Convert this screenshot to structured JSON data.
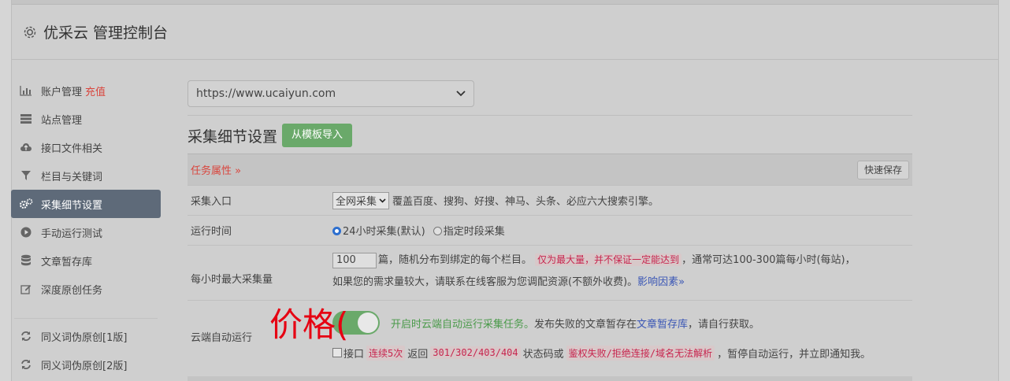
{
  "header": {
    "title": "优采云 管理控制台",
    "icon": "gear-icon"
  },
  "sidebar": {
    "items": [
      {
        "label": "账户管理",
        "tag": "充值",
        "icon": "bar-chart-icon"
      },
      {
        "label": "站点管理",
        "icon": "server-icon"
      },
      {
        "label": "接口文件相关",
        "icon": "cloud-upload-icon"
      },
      {
        "label": "栏目与关键词",
        "icon": "filter-icon"
      },
      {
        "label": "采集细节设置",
        "icon": "cogs-icon",
        "active": true
      },
      {
        "label": "手动运行测试",
        "icon": "play-icon"
      },
      {
        "label": "文章暂存库",
        "icon": "database-icon"
      },
      {
        "label": "深度原创任务",
        "icon": "edit-icon"
      },
      {
        "label": "同义词伪原创[1版]",
        "icon": "refresh-icon"
      },
      {
        "label": "同义词伪原创[2版]",
        "icon": "refresh-icon"
      }
    ]
  },
  "main": {
    "site_select": {
      "value": "https://www.ucaiyun.com"
    },
    "section_title": "采集细节设置",
    "import_button": "从模板导入",
    "props_label": "任务属性 »",
    "quick_save": "快速保存",
    "rows": {
      "entry": {
        "label": "采集入口",
        "select": "全网采集",
        "desc": "覆盖百度、搜狗、好搜、神马、头条、必应六大搜索引擎。"
      },
      "time": {
        "label": "运行时间",
        "opt1": "24小时采集(默认)",
        "opt2": "指定时段采集"
      },
      "max": {
        "label": "每小时最大采集量",
        "value": "100",
        "t1": "篇，随机分布到绑定的每个栏目。",
        "code": "仅为最大量，并不保证一定能达到",
        "t2": "，通常可达100-300篇每小时(每站)，",
        "t3": "如果您的需求量较大，请联系在线客服为您调配资源(不额外收费)。",
        "link": "影响因素»"
      },
      "cloud": {
        "label": "云端自动运行",
        "green": "开启时云端自动运行采集任务。",
        "t1": "发布失败的文章暂存在",
        "link": "文章暂存库",
        "t2": "，请自行获取。",
        "chk_label": "接口",
        "code1": "连续5次",
        "t3": "返回",
        "code2": "301/302/403/404",
        "t4": "状态码或",
        "code3": "鉴权失败/拒绝连接/域名无法解析",
        "t5": "，暂停自动运行，并立即通知我。"
      }
    }
  },
  "overlay": {
    "text": "价格("
  }
}
